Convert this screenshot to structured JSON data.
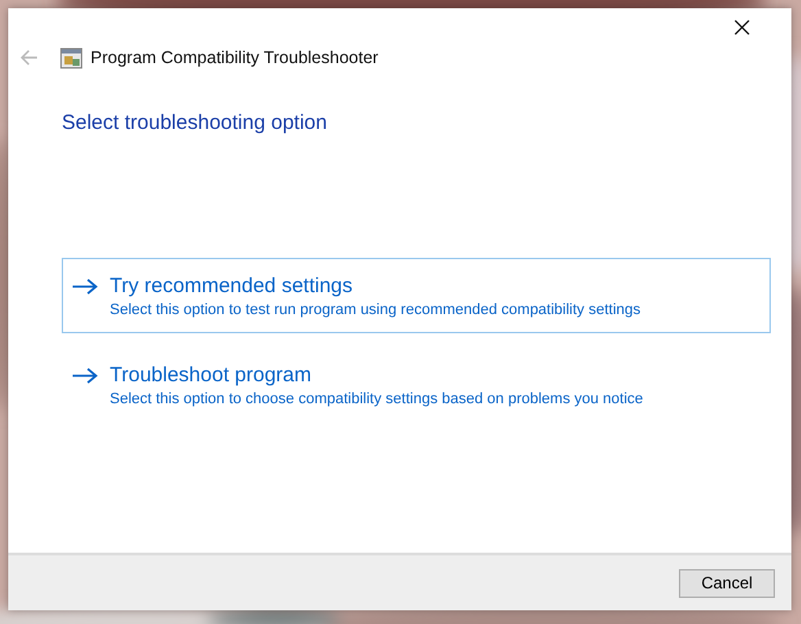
{
  "window": {
    "title": "Program Compatibility Troubleshooter"
  },
  "heading": "Select troubleshooting option",
  "options": [
    {
      "title": "Try recommended settings",
      "description": "Select this option to test run program using recommended compatibility settings",
      "selected": true
    },
    {
      "title": "Troubleshoot program",
      "description": "Select this option to choose compatibility settings based on problems you notice",
      "selected": false
    }
  ],
  "buttons": [
    "Cancel"
  ]
}
